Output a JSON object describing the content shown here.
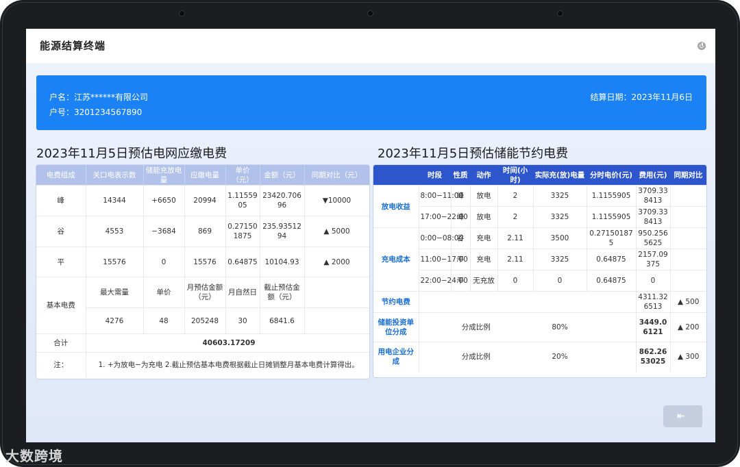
{
  "app": {
    "title": "能源结算终端"
  },
  "info": {
    "account_name": "户名：江苏******有限公司",
    "account_number": "户号：3201234567890",
    "settle_date": "结算日期：2023年11月6日"
  },
  "left": {
    "title": "2023年11月5日预估电网应缴电费",
    "headers": [
      "电费组成",
      "关口电表示数",
      "储能充放电量",
      "应缴电量",
      "单价（元）",
      "金额（元）",
      "同期对比（元）"
    ],
    "rows": [
      {
        "name": "峰",
        "meter": "14344",
        "storage": "+6650",
        "payable": "20994",
        "price": "1.1155905",
        "amount": "23420.70696",
        "compare": "▼10000"
      },
      {
        "name": "谷",
        "meter": "4553",
        "storage": "−3684",
        "payable": "869",
        "price": "0.271501875",
        "amount": "235.9351294",
        "compare": "▲ 5000"
      },
      {
        "name": "平",
        "meter": "15576",
        "storage": "0",
        "payable": "15576",
        "price": "0.64875",
        "amount": "10104.93",
        "compare": "▲ 2000"
      }
    ],
    "basic": {
      "label": "基本电费",
      "headers": [
        "最大需量",
        "单价",
        "月预估金额（元）",
        "月自然日",
        "截止预估金额（元）"
      ],
      "values": [
        "4276",
        "48",
        "205248",
        "30",
        "6841.6"
      ]
    },
    "total": {
      "label": "合计",
      "value": "40603.17209"
    },
    "note": {
      "label": "注：",
      "text": "1. +为放电−为充电  2.截止预估基本电费根据截止日摊销整月基本电费计算得出。"
    }
  },
  "right": {
    "title": "2023年11月5日预估储能节约电费",
    "headers": [
      "",
      "时段",
      "性质",
      "动作",
      "时间(小时)",
      "实际充(放)电量",
      "分时电价(元)",
      "费用(元)",
      "同期对比"
    ],
    "group_discharge": "放电收益",
    "group_charge": "充电成本",
    "rows": [
      {
        "period": "8:00−11:00",
        "nature": "峰",
        "action": "放电",
        "hours": "2",
        "energy": "3325",
        "price": "1.1155905",
        "cost": "3709.338413"
      },
      {
        "period": "17:00−22:00",
        "nature": "峰",
        "action": "放电",
        "hours": "2",
        "energy": "3325",
        "price": "1.1155905",
        "cost": "3709.338413"
      },
      {
        "period": "0:00−08:00",
        "nature": "谷",
        "action": "充电",
        "hours": "2.11",
        "energy": "3500",
        "price": "0.271501875",
        "cost": "950.2565625"
      },
      {
        "period": "11:00−17:00",
        "nature": "平",
        "action": "充电",
        "hours": "2.11",
        "energy": "3325",
        "price": "0.64875",
        "cost": "2157.09375"
      },
      {
        "period": "22:00−24:00",
        "nature": "平",
        "action": "无充放",
        "hours": "0",
        "energy": "0",
        "price": "0.64875",
        "cost": "0"
      }
    ],
    "saving": {
      "label": "节约电费",
      "cost": "4311.326513",
      "compare": "▲ 500"
    },
    "investor": {
      "label": "储能投资单位分成",
      "ratio_label": "分成比例",
      "ratio": "80%",
      "cost": "3449.06121",
      "compare": "▲ 200"
    },
    "enterprise": {
      "label": "用电企业分成",
      "ratio_label": "分成比例",
      "ratio": "20%",
      "cost": "862.2653025",
      "compare": "▲ 300"
    }
  },
  "back_button": {
    "icon": "exit-to-left-icon",
    "glyph": "⇤"
  },
  "watermark": "大数跨境",
  "colors": {
    "accent": "#1a82f5",
    "header_right": "#2e56cc",
    "header_left": "#b2c1ea",
    "link": "#1a6fd6"
  }
}
